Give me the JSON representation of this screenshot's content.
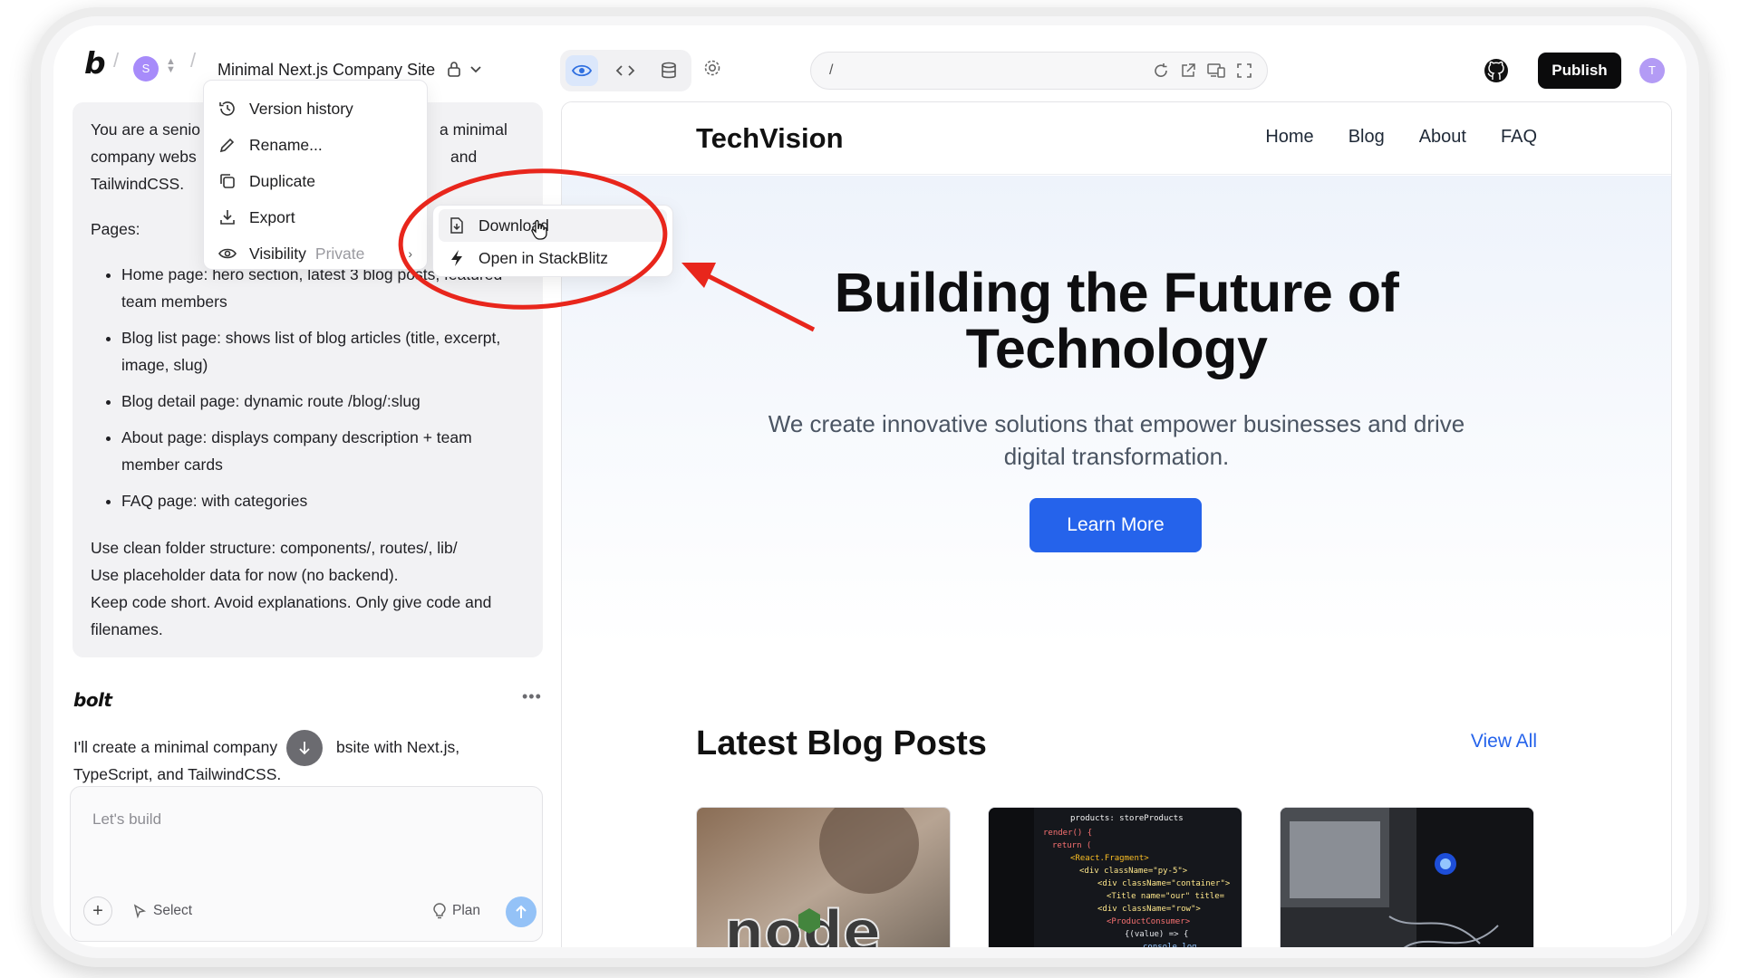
{
  "topbar": {
    "logo": "b",
    "workspace_initial": "S",
    "project_title": "Minimal Next.js Company Site",
    "url_path": "/",
    "publish_label": "Publish",
    "user_initial": "T"
  },
  "project_menu": {
    "items": [
      {
        "label": "Version history",
        "icon": "history-icon"
      },
      {
        "label": "Rename...",
        "icon": "pencil-icon"
      },
      {
        "label": "Duplicate",
        "icon": "copy-icon"
      },
      {
        "label": "Export",
        "icon": "download-icon"
      },
      {
        "label": "Visibility",
        "icon": "eye-icon",
        "value": "Private"
      }
    ]
  },
  "export_submenu": {
    "items": [
      {
        "label": "Download",
        "icon": "file-download-icon"
      },
      {
        "label": "Open in StackBlitz",
        "icon": "lightning-icon"
      }
    ]
  },
  "prompt": {
    "intro_left": "You are a senio",
    "intro_right": "a minimal",
    "line2_left": "company webs",
    "line2_right": "and",
    "line3": "TailwindCSS.",
    "pages_heading": "Pages:",
    "bullets": [
      "Home page: hero section, latest 3 blog posts, featured team members",
      "Blog list page: shows list of blog articles (title, excerpt, image, slug)",
      "Blog detail page: dynamic route /blog/:slug",
      "About page: displays company description + team member cards",
      "FAQ page: with categories"
    ],
    "outro": [
      "Use clean folder structure: components/,  routes/, lib/",
      "Use placeholder data for now (no backend).",
      "Keep code short. Avoid explanations. Only give code and filenames."
    ]
  },
  "assistant": {
    "name": "bolt",
    "reply_line1_left": "I'll create a minimal company",
    "reply_line1_right": "bsite with Next.js,",
    "reply_line2": "TypeScript, and TailwindCSS."
  },
  "chat_input": {
    "placeholder": "Let's build",
    "select_label": "Select",
    "plan_label": "Plan"
  },
  "site": {
    "brand": "TechVision",
    "nav": [
      "Home",
      "Blog",
      "About",
      "FAQ"
    ],
    "hero_title_line1": "Building the Future of",
    "hero_title_line2": "Technology",
    "hero_subtitle": "We create innovative solutions that empower businesses and drive digital transformation.",
    "cta_label": "Learn More",
    "blog_heading": "Latest Blog Posts",
    "view_all_label": "View All",
    "blog_cards": [
      {
        "image": "node-logo-photo"
      },
      {
        "image": "code-editor-photo"
      },
      {
        "image": "computer-hardware-photo"
      }
    ]
  },
  "colors": {
    "accent_blue": "#2563eb",
    "annotation_red": "#e8261c",
    "publish_bg": "#0b0b0c"
  }
}
